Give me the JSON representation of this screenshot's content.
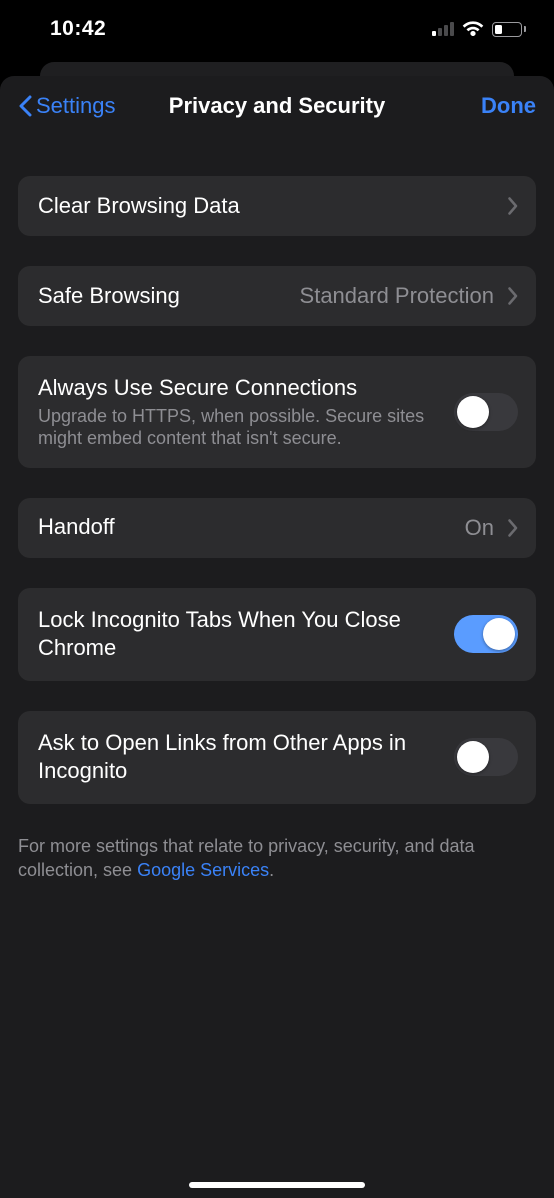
{
  "status": {
    "time": "10:42"
  },
  "nav": {
    "back_label": "Settings",
    "title": "Privacy and Security",
    "done_label": "Done"
  },
  "rows": {
    "clear_browsing": {
      "title": "Clear Browsing Data"
    },
    "safe_browsing": {
      "title": "Safe Browsing",
      "value": "Standard Protection"
    },
    "secure_connections": {
      "title": "Always Use Secure Connections",
      "subtitle": "Upgrade to HTTPS, when possible. Secure sites might embed content that isn't secure."
    },
    "handoff": {
      "title": "Handoff",
      "value": "On"
    },
    "lock_incognito": {
      "title": "Lock Incognito Tabs When You Close Chrome"
    },
    "open_links_incognito": {
      "title": "Ask to Open Links from Other Apps in Incognito"
    }
  },
  "footer": {
    "prefix": "For more settings that relate to privacy, security, and data collection, see ",
    "link": "Google Services",
    "suffix": "."
  }
}
